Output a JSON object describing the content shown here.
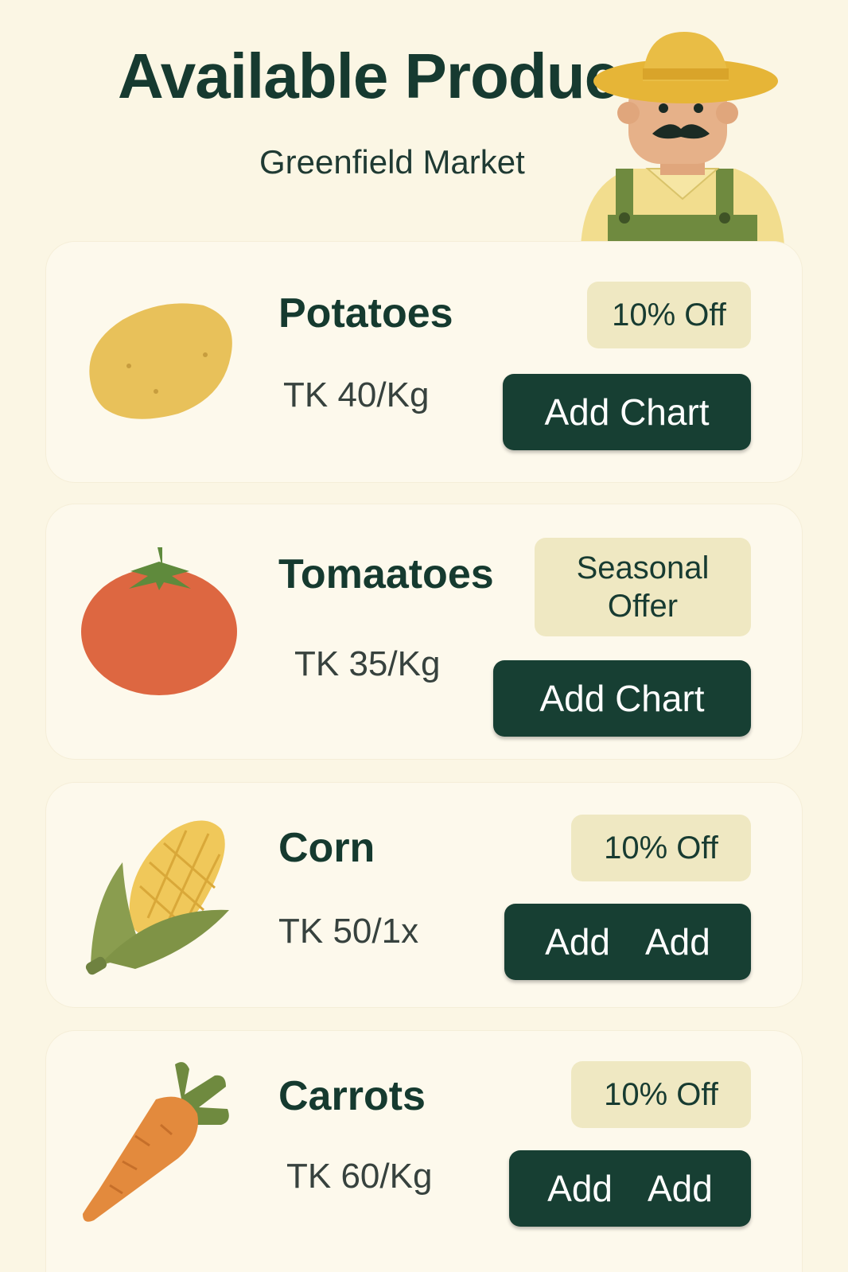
{
  "header": {
    "title": "Available Produce",
    "subtitle": "Greenfield Market",
    "mascot_icon": "farmer-icon"
  },
  "items": [
    {
      "name": "Potatoes",
      "price": "TK 40/Kg",
      "badge": "10% Off",
      "button_label": "Add Chart",
      "icon": "potato-icon"
    },
    {
      "name": "Tomaatoes",
      "price": "TK 35/Kg",
      "badge": "Seasonal Offer",
      "button_label": "Add Chart",
      "icon": "tomato-icon"
    },
    {
      "name": "Corn",
      "price": "TK 50/1x",
      "badge": "10% Off",
      "button_label_parts": [
        "Add",
        "Add"
      ],
      "icon": "corn-icon"
    },
    {
      "name": "Carrots",
      "price": "TK 60/Kg",
      "badge": "10% Off",
      "button_label_parts": [
        "Add",
        "Add"
      ],
      "icon": "carrot-icon"
    }
  ],
  "colors": {
    "background": "#fbf6e4",
    "card": "#fdf9ec",
    "accent_dark_green": "#173f33",
    "badge": "#efe8c2"
  }
}
